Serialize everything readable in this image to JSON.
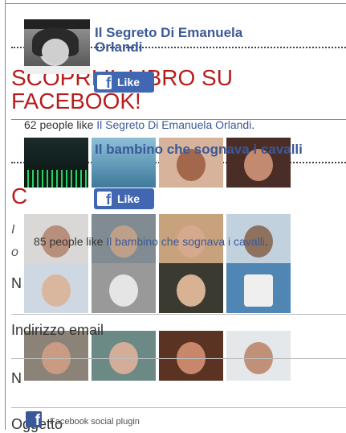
{
  "page": {
    "title_line1": "SCOPRI IL LIBRO SU",
    "title_line2": "FACEBOOK!",
    "section_c": "C",
    "form_italic_1": "I",
    "form_italic_2": "o",
    "label_nome": "N",
    "label_indirizzo": "Indirizzo email",
    "label_numero": "N",
    "label_oggetto": "Oggetto"
  },
  "fb_page1": {
    "name": "Il Segreto Di Emanuela Orlandi",
    "like_label": "Like",
    "likes_text": "62 people like ",
    "likes_link": "Il Segreto Di Emanuela Orlandi",
    "likes_suffix": "."
  },
  "fb_page2": {
    "name": "Il bambino che sognava i cavalli",
    "like_label": "Like",
    "likes_text": "85 people like ",
    "likes_link": "Il bambino che sognava i cavalli",
    "likes_suffix": "."
  },
  "fb_plugin": {
    "footer": "Facebook social plugin"
  },
  "colors": {
    "brand_blue": "#3b5998",
    "like_blue": "#4267b2",
    "heading_red": "#b81d1d"
  }
}
